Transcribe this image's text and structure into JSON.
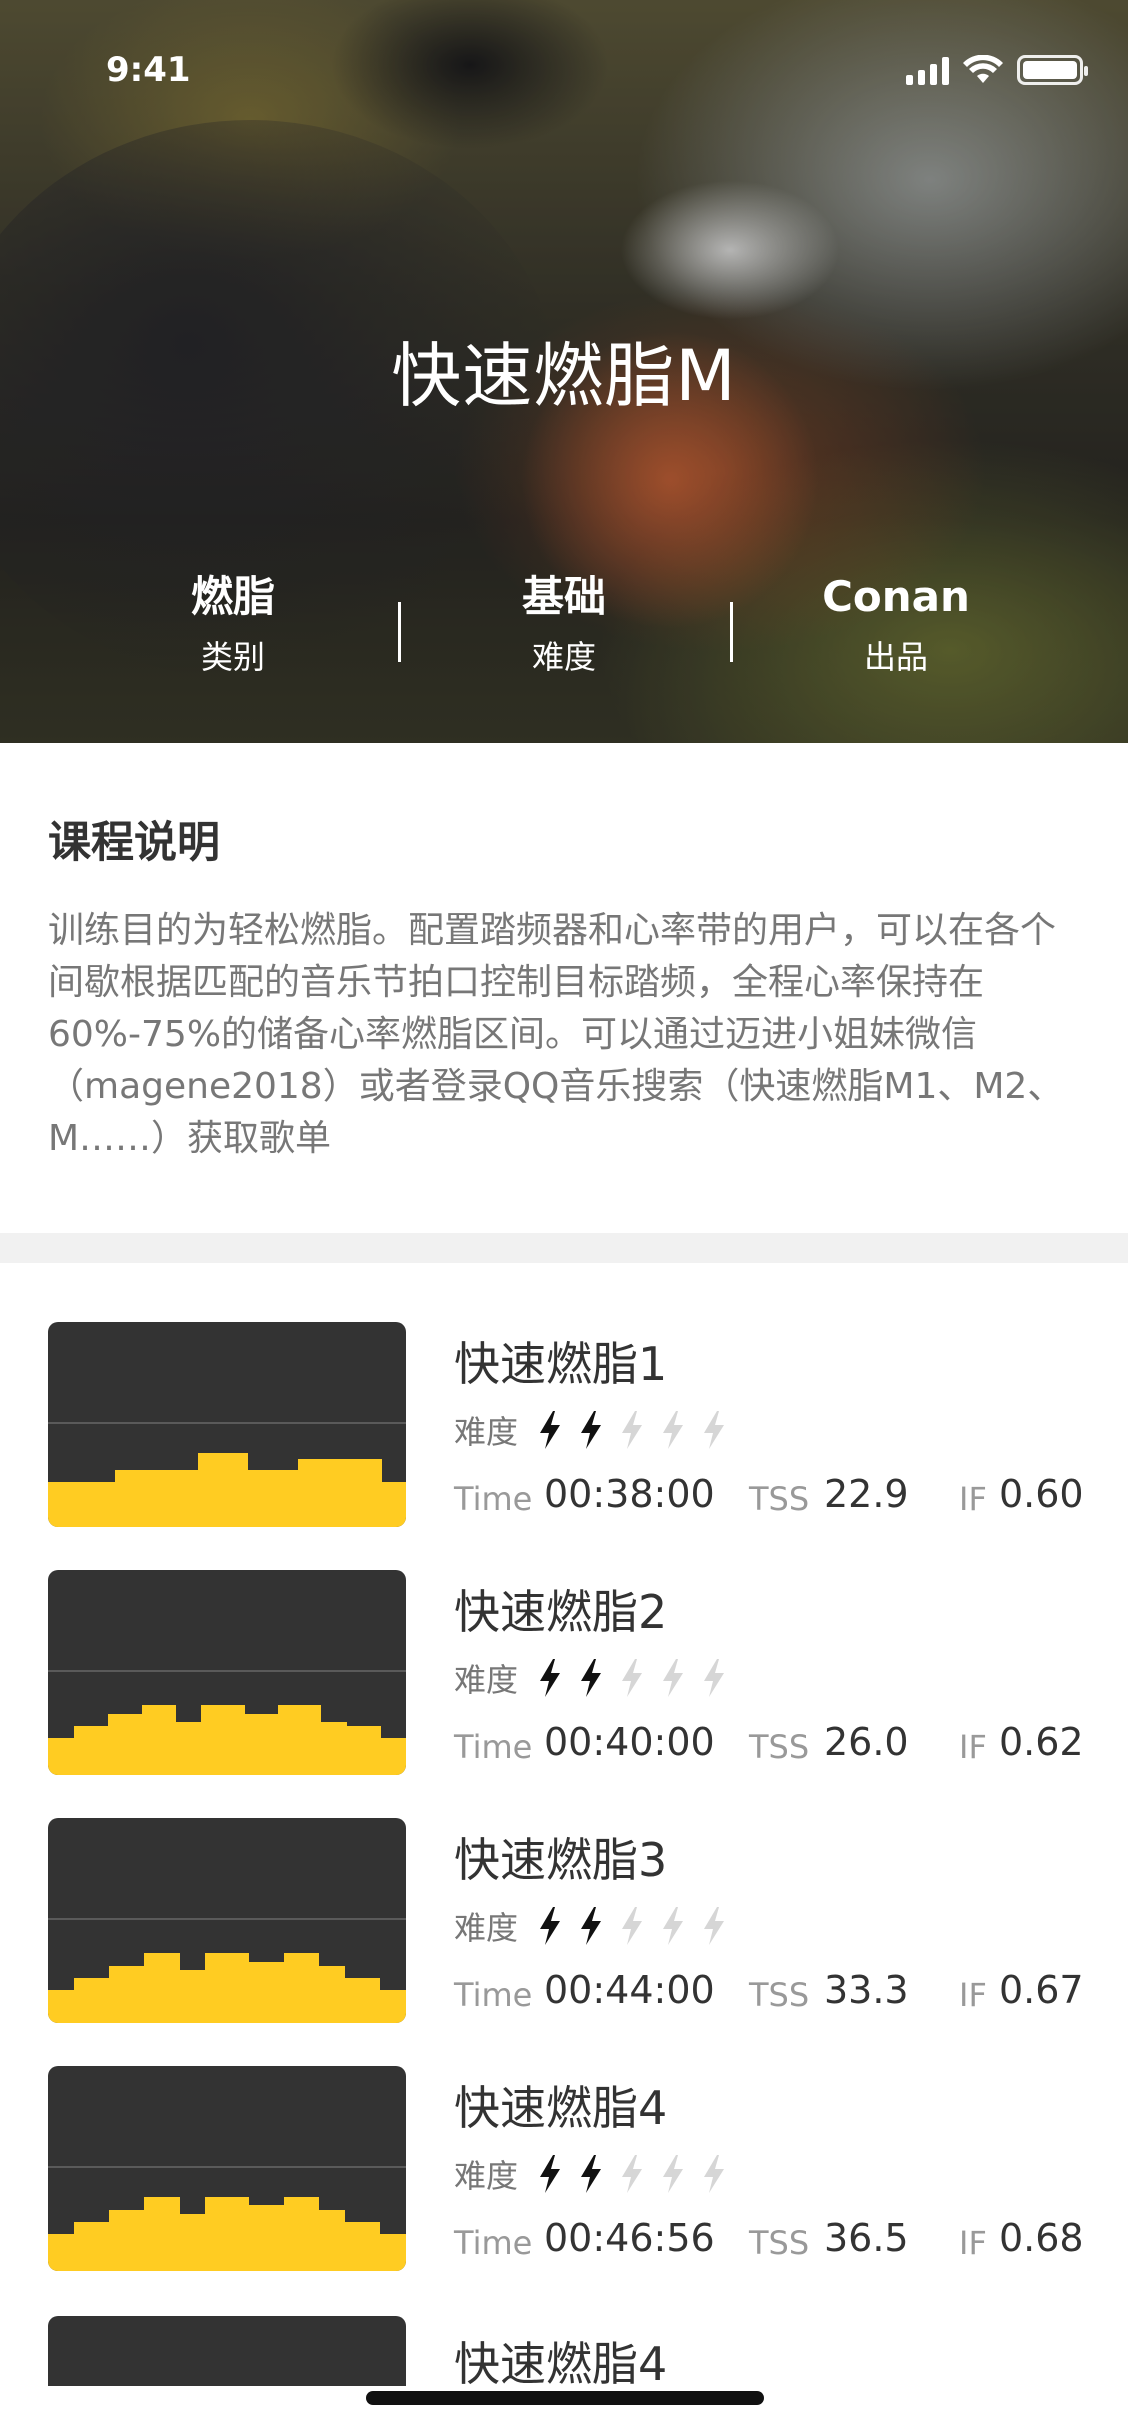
{
  "status_bar": {
    "time": "9:41"
  },
  "hero": {
    "title": "快速燃脂M",
    "stats": [
      {
        "value": "燃脂",
        "label": "类别"
      },
      {
        "value": "基础",
        "label": "难度"
      },
      {
        "value": "Conan",
        "label": "出品"
      }
    ]
  },
  "description": {
    "title": "课程说明",
    "text": "训练目的为轻松燃脂。配置踏频器和心率带的用户，可以在各个间歇根据匹配的音乐节拍口控制目标踏频，全程心率保持在60%-75%的储备心率燃脂区间。可以通过迈进小姐妹微信（magene2018）或者登录QQ音乐搜索（快速燃脂M1、M2、M……）获取歌单"
  },
  "labels": {
    "difficulty": "难度",
    "time": "Time",
    "tss": "TSS",
    "if": "IF"
  },
  "colors": {
    "accent": "#ffcc22",
    "thumb_bg": "#333333",
    "bolt_active": "#111111",
    "bolt_inactive": "#d6d6d6"
  },
  "courses": [
    {
      "title": "快速燃脂1",
      "difficulty": 2,
      "time": "00:38:00",
      "tss": "22.9",
      "if": "0.60",
      "profile": [
        0.22,
        0.22,
        0.22,
        0.22,
        0.22,
        0.22,
        0.22,
        0.22,
        0.28,
        0.28,
        0.28,
        0.28,
        0.28,
        0.28,
        0.28,
        0.28,
        0.28,
        0.28,
        0.36,
        0.36,
        0.36,
        0.36,
        0.36,
        0.36,
        0.28,
        0.28,
        0.28,
        0.28,
        0.28,
        0.28,
        0.33,
        0.33,
        0.33,
        0.33,
        0.33,
        0.33,
        0.33,
        0.33,
        0.33,
        0.33,
        0.22,
        0.22,
        0.22
      ]
    },
    {
      "title": "快速燃脂2",
      "difficulty": 2,
      "time": "00:40:00",
      "tss": "26.0",
      "if": "0.62",
      "profile": [
        0.18,
        0.18,
        0.18,
        0.24,
        0.24,
        0.24,
        0.24,
        0.3,
        0.3,
        0.3,
        0.3,
        0.34,
        0.34,
        0.34,
        0.34,
        0.26,
        0.26,
        0.26,
        0.34,
        0.34,
        0.34,
        0.34,
        0.34,
        0.3,
        0.3,
        0.3,
        0.3,
        0.34,
        0.34,
        0.34,
        0.34,
        0.34,
        0.26,
        0.26,
        0.26,
        0.24,
        0.24,
        0.24,
        0.24,
        0.18,
        0.18,
        0.18
      ]
    },
    {
      "title": "快速燃脂3",
      "difficulty": 2,
      "time": "00:44:00",
      "tss": "33.3",
      "if": "0.67",
      "profile": [
        0.16,
        0.16,
        0.16,
        0.22,
        0.22,
        0.22,
        0.22,
        0.28,
        0.28,
        0.28,
        0.28,
        0.34,
        0.34,
        0.34,
        0.34,
        0.26,
        0.26,
        0.26,
        0.34,
        0.34,
        0.34,
        0.34,
        0.34,
        0.3,
        0.3,
        0.3,
        0.3,
        0.34,
        0.34,
        0.34,
        0.34,
        0.28,
        0.28,
        0.28,
        0.22,
        0.22,
        0.22,
        0.22,
        0.16,
        0.16,
        0.16
      ]
    },
    {
      "title": "快速燃脂4",
      "difficulty": 2,
      "time": "00:46:56",
      "tss": "36.5",
      "if": "0.68",
      "profile": [
        0.18,
        0.18,
        0.18,
        0.24,
        0.24,
        0.24,
        0.24,
        0.3,
        0.3,
        0.3,
        0.3,
        0.36,
        0.36,
        0.36,
        0.36,
        0.28,
        0.28,
        0.28,
        0.36,
        0.36,
        0.36,
        0.36,
        0.36,
        0.32,
        0.32,
        0.32,
        0.32,
        0.36,
        0.36,
        0.36,
        0.36,
        0.3,
        0.3,
        0.3,
        0.24,
        0.24,
        0.24,
        0.24,
        0.18,
        0.18,
        0.18
      ]
    }
  ],
  "peek_course": {
    "title": "快速燃脂4"
  }
}
